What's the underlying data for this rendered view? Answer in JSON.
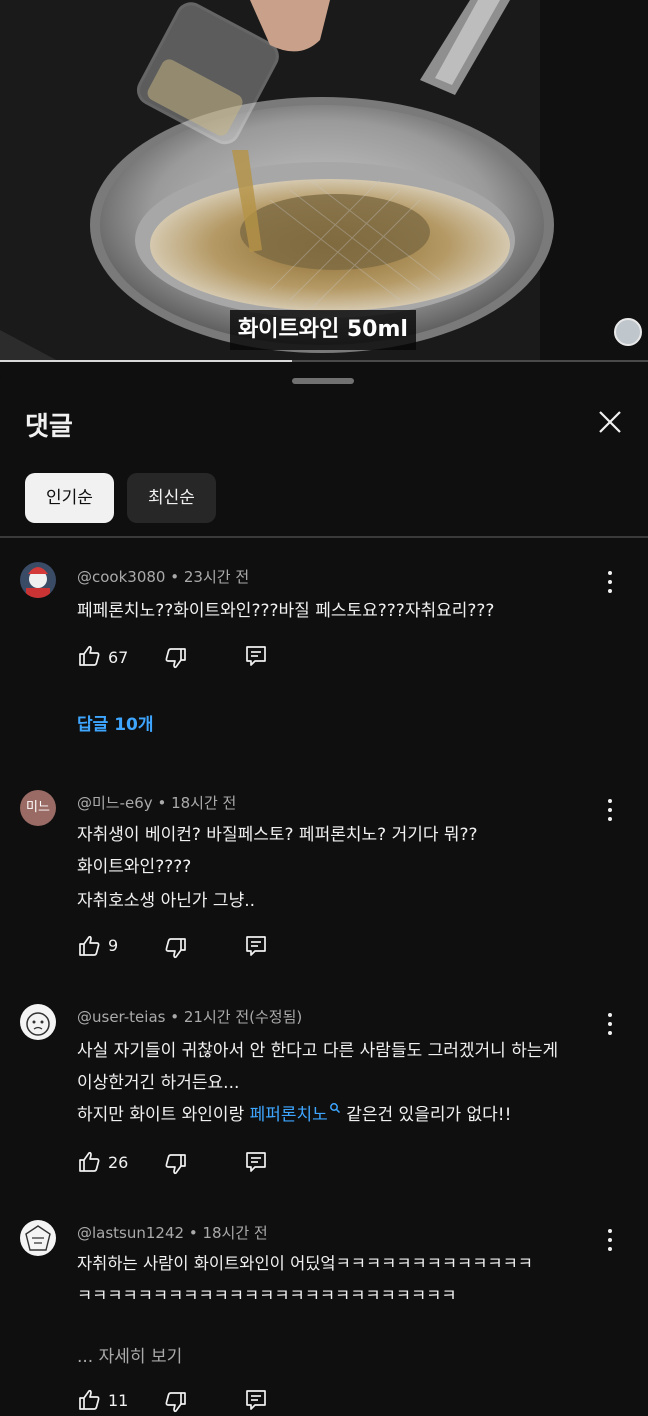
{
  "video": {
    "subtitle": "화이트와인 50ml",
    "progress_percent": 45
  },
  "sheet": {
    "title": "댓글",
    "sort_chips": [
      "인기순",
      "최신순"
    ],
    "selected_sort": "인기순"
  },
  "comments": [
    {
      "author": "@cook3080",
      "time": "23시간 전",
      "lines": [
        "페페론치노??화이트와인???바질 페스토요???자취요리???"
      ],
      "likes": "67",
      "replies": "답글 10개"
    },
    {
      "author": "@미느-e6y",
      "avatar_text": "미느",
      "time": "18시간 전",
      "lines": [
        "자취생이 베이컨? 바질페스토? 페퍼론치노? 거기다 뭐??",
        "화이트와인????",
        "자취호소생 아닌가 그냥.."
      ],
      "likes": "9"
    },
    {
      "author": "@user-teias",
      "time": "21시간 전(수정됨)",
      "lines": [
        "사실 자기들이 귀찮아서 안 한다고 다른 사람들도 그러겠거니 하는게",
        "이상한거긴 하거든요..."
      ],
      "line3_before": "하지만 화이트 와인이랑 ",
      "line3_link": "페퍼론치노",
      "line3_after": " 같은건 있을리가 없다!!",
      "likes": "26"
    },
    {
      "author": "@lastsun1242",
      "time": "18시간 전",
      "lines": [
        "자취하는 사람이 화이트와인이 어딨엌ㅋㅋㅋㅋㅋㅋㅋㅋㅋㅋㅋㅋㅋ",
        "ㅋㅋㅋㅋㅋㅋㅋㅋㅋㅋㅋㅋㅋㅋㅋㅋㅋㅋㅋㅋㅋㅋㅋㅋㅋ"
      ],
      "see_more": "... 자세히 보기",
      "likes": "11"
    }
  ],
  "icons": {
    "like": "thumb-up-icon",
    "dislike": "thumb-down-icon",
    "reply": "comment-icon",
    "more": "more-vert-icon",
    "close": "close-icon",
    "search_hint": "search-icon"
  },
  "colors": {
    "background": "#0f0f0f",
    "link": "#3ea6ff",
    "meta": "#aaaaaa"
  }
}
